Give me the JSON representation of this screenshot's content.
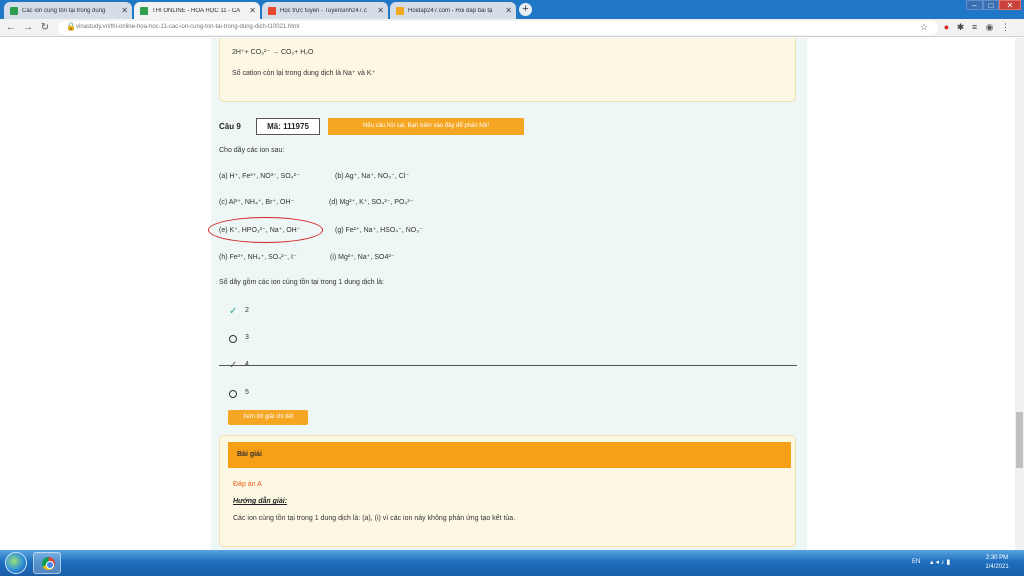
{
  "browser": {
    "tabs": [
      {
        "title": "Các ion cùng tồn tại trong dung",
        "favicon_color": "#2e9e4f",
        "active": false
      },
      {
        "title": "THI ONLINE - HÓA HỌC 11 - CÁ",
        "favicon_color": "#2e9e4f",
        "active": true
      },
      {
        "title": "Học trực tuyến - Tuyensinh247.c",
        "favicon_color": "#e8492e",
        "active": false
      },
      {
        "title": "Hoidap247.com - Hỏi đáp bài tậ",
        "favicon_color": "#f2a61b",
        "active": false
      }
    ],
    "url": "vinastudy.vn/thi-online-hoa-hoc-11-cac-ion-cung-ton-tai-trong-dung-dich-t10021.html"
  },
  "previous_answer": {
    "equation": "2H⁺+ CO₃²⁻  →  CO₂+ H₂O",
    "note": "Số cation còn lại trong dung dịch là Na⁺ và K⁺"
  },
  "question": {
    "label": "Câu 9",
    "code": "Mã: 111975",
    "report_label": "Nếu câu hỏi sai. Bạn bấm vào đây để phản hồi!",
    "intro": "Cho dãy các ion sau:",
    "options": [
      "(a) H⁺, Fe³⁺, NO³⁻, SO₄²⁻",
      "(b) Ag⁺, Na⁺, NO₃⁻, Cl⁻",
      "(c) Al³⁺, NH₄⁺, Br⁺, OH⁻",
      "(d) Mg²⁺, K⁺, SO₄²⁻, PO₄³⁻",
      "(e) K⁺, HPO₃²⁻, Na⁺, OH⁻",
      "(g) Fe²⁺, Na⁺, HSO₄⁻, NO₃⁻",
      "(h) Fe³⁺, NH₄⁺, SO₄²⁻, I⁻",
      "(i) Mg²⁺, Na⁺, SO4²⁻"
    ],
    "prompt": "Số dãy gồm các ion cùng tồn tại trong 1 dung dịch là:",
    "answers": [
      "2",
      "3",
      "4",
      "5"
    ],
    "detail_button": "Xem lời giải chi tiết"
  },
  "solution": {
    "heading": "Bài giải",
    "answer": "Đáp án A",
    "guide_label": "Hướng dẫn giải:",
    "text": "Các ion cùng tồn tại trong 1 dung dịch là: (a), (i) vì các ion này không phản ứng tạo kết tủa."
  },
  "taskbar": {
    "language": "EN",
    "time": "2:30 PM",
    "date": "1/4/2021"
  }
}
